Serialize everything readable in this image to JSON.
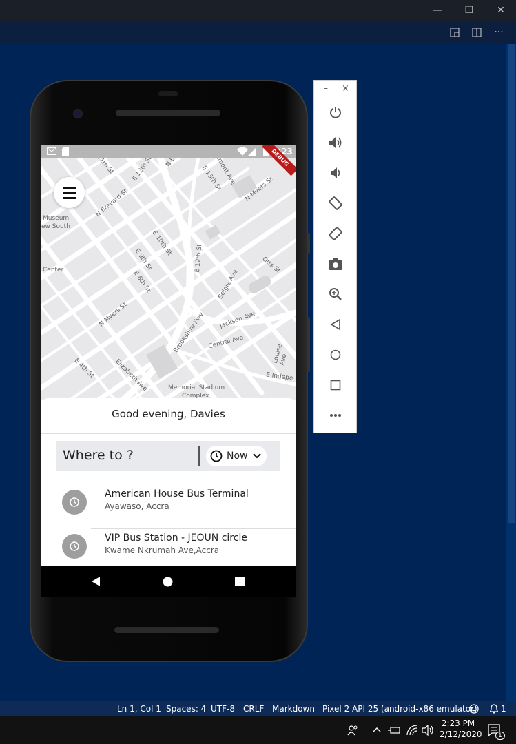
{
  "window": {
    "minimize": "—",
    "restore": "❐",
    "close": "✕"
  },
  "toolbar": {
    "more": "···"
  },
  "device": {
    "status": {
      "time": "2:23",
      "debug": "DEBUG"
    },
    "map": {
      "labels": [
        {
          "t": "11th St"
        },
        {
          "t": "E 12th St"
        },
        {
          "t": "N B"
        },
        {
          "t": "Belmont Ave"
        },
        {
          "t": "E 13th St"
        },
        {
          "t": "N Myers St"
        },
        {
          "t": "N Brevard St"
        },
        {
          "t": "Museum"
        },
        {
          "t": "ew South"
        },
        {
          "t": "E 10th St"
        },
        {
          "t": "E 12th St"
        },
        {
          "t": "E 9th St"
        },
        {
          "t": "Otts St"
        },
        {
          "t": "Center"
        },
        {
          "t": "E 8th St"
        },
        {
          "t": "Seigle Ave"
        },
        {
          "t": "N Myers St"
        },
        {
          "t": "Brookshire Fwy"
        },
        {
          "t": "Jackson Ave"
        },
        {
          "t": "Central Ave"
        },
        {
          "t": "Louise Ave"
        },
        {
          "t": "E 4th St"
        },
        {
          "t": "Elizabeth Ave"
        },
        {
          "t": "Memorial Stadium"
        },
        {
          "t": "Complex"
        },
        {
          "t": "E Indepe"
        }
      ]
    },
    "greeting": "Good evening, Davies",
    "where_label": "Where to ?",
    "time_select": "Now",
    "places": [
      {
        "name": "American House Bus Terminal",
        "sub": "Ayawaso, Accra"
      },
      {
        "name": "VIP Bus Station - JEOUN circle",
        "sub": "Kwame Nkrumah Ave,Accra"
      }
    ]
  },
  "emulator_toolbar": {
    "minimize": "–",
    "close": "×",
    "buttons": [
      "power",
      "volume-up",
      "volume-down",
      "rotate-left",
      "rotate-right",
      "screenshot",
      "zoom",
      "back",
      "home",
      "overview",
      "more"
    ]
  },
  "statusbar": {
    "position": "Ln 1, Col 1",
    "spaces": "Spaces: 4",
    "encoding": "UTF-8",
    "eol": "CRLF",
    "language": "Markdown",
    "device": "Pixel 2 API 25 (android-x86 emulator)",
    "notifications": "1"
  },
  "taskbar": {
    "time": "2:23 PM",
    "date": "2/12/2020",
    "notif_count": "1"
  },
  "colors": {
    "background": "#012456",
    "statusbar": "#0e2a56",
    "taskbar": "#121212"
  }
}
